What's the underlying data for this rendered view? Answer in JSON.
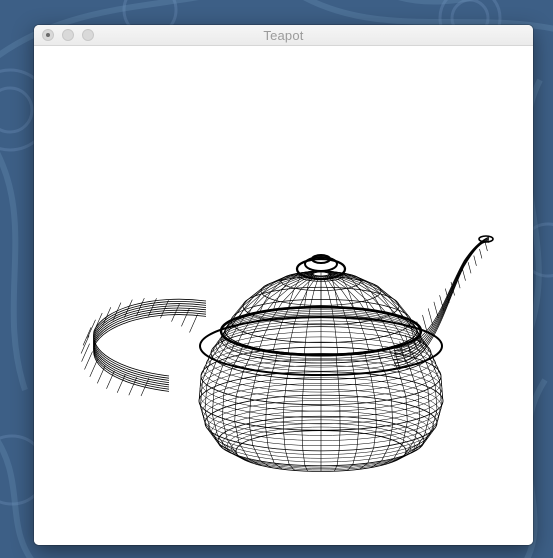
{
  "window": {
    "title": "Teapot",
    "controls": [
      "close-icon",
      "minimize-icon",
      "zoom-icon"
    ]
  },
  "viewport": {
    "subject": "teapot-wireframe",
    "render_mode": "wireframe",
    "line_color": "#000000",
    "background_color": "#ffffff"
  },
  "desktop": {
    "wallpaper_color": "#3d5f86"
  }
}
